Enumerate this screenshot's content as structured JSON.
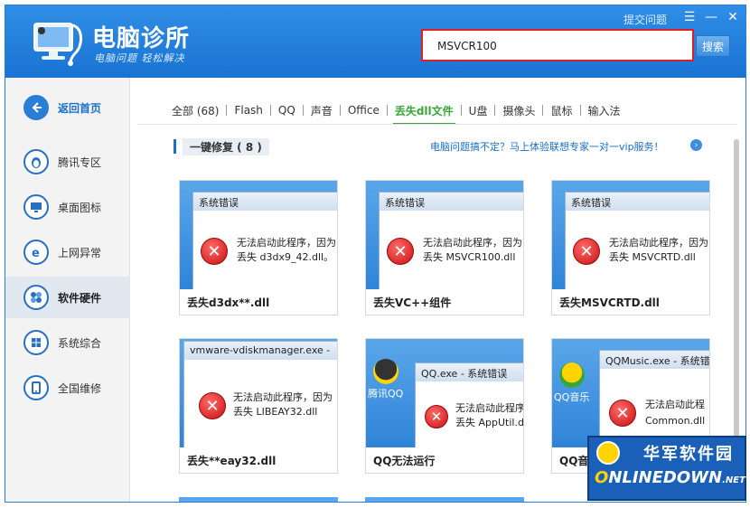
{
  "header": {
    "app_title": "电脑诊所",
    "app_subtitle": "电脑问题 轻松解决",
    "search_value": "MSVCR100",
    "search_button": "搜索",
    "feedback_link": "提交问题",
    "menu_glyph": "☰",
    "minimize_glyph": "—",
    "close_glyph": "✕"
  },
  "sidebar": {
    "items": [
      {
        "label": "返回首页"
      },
      {
        "label": "腾讯专区"
      },
      {
        "label": "桌面图标"
      },
      {
        "label": "上网异常"
      },
      {
        "label": "软件硬件"
      },
      {
        "label": "系统综合"
      },
      {
        "label": "全国维修"
      }
    ]
  },
  "tabs": [
    {
      "label": "全部 (68)"
    },
    {
      "label": "Flash"
    },
    {
      "label": "QQ"
    },
    {
      "label": "声音"
    },
    {
      "label": "Office"
    },
    {
      "label": "丢失dll文件"
    },
    {
      "label": "U盘"
    },
    {
      "label": "摄像头"
    },
    {
      "label": "鼠标"
    },
    {
      "label": "输入法"
    }
  ],
  "section": {
    "title": "一键修复 ( 8 )",
    "promo": "电脑问题搞不定？马上体验联想专家一对一vip服务！",
    "promo_icon": "›"
  },
  "cards": [
    {
      "caption": "丢失d3dx**.dll",
      "dialog_title": "系统错误",
      "line1": "无法启动此程序，因为",
      "line2": "丢失 d3dx9_42.dll。"
    },
    {
      "caption": "丢失VC++组件",
      "dialog_title": "系统错误",
      "line1": "无法启动此程序，因为",
      "line2": "丢失 MSVCR100.dll"
    },
    {
      "caption": "丢失MSVCRTD.dll",
      "dialog_title": "系统错误",
      "line1": "无法启动此程序，因为",
      "line2": "丢失 MSVCRTD.dll"
    },
    {
      "caption": "丢失**eay32.dll",
      "dialog_title": "vmware-vdiskmanager.exe - ",
      "line1": "无法启动此程序，因为",
      "line2": "丢失 LIBEAY32.dll"
    },
    {
      "caption": "QQ无法运行",
      "dialog_title": "QQ.exe - 系统错误",
      "line1": "无法启动此程序",
      "line2": "丢失 AppUtil.dll",
      "desk_label": "腾讯QQ"
    },
    {
      "caption": "QQ音",
      "dialog_title": "QQMusic.exe - 系统错误",
      "line1": "无法启动此程",
      "line2": "Common.dll",
      "desk_label": "QQ音乐"
    }
  ],
  "error_glyph": "✕",
  "watermark": {
    "top": "华军软件园",
    "bottom_o": "O",
    "bottom_rest": "NLINEDOWN",
    "bottom_net": ".NET"
  },
  "colors": {
    "header_blue": "#1a73d3",
    "active_tab_green": "#3aa63a",
    "link_blue": "#1a6fc8",
    "search_highlight": "#e02020"
  }
}
